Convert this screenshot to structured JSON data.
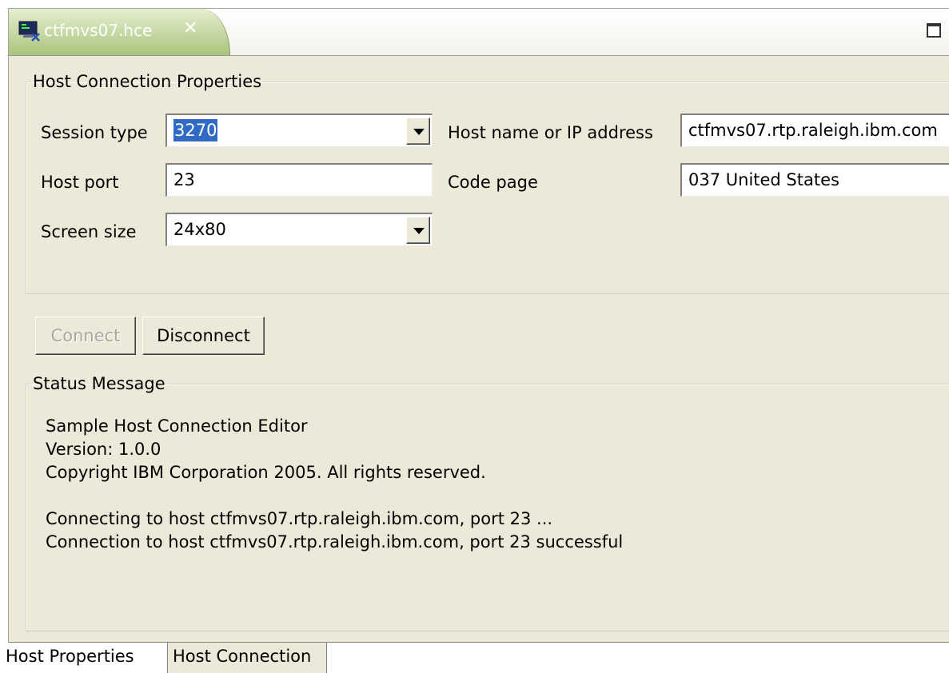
{
  "editor_tab": {
    "title": "ctfmvs07.hce",
    "icon": "terminal-icon",
    "close_icon": "close-icon"
  },
  "maximize_icon": "maximize-icon",
  "host_connection": {
    "legend": "Host Connection Properties",
    "session_type_label": "Session type",
    "session_type_value": "3270",
    "host_name_label": "Host name or IP address",
    "host_name_value": "ctfmvs07.rtp.raleigh.ibm.com",
    "host_port_label": "Host port",
    "host_port_value": "23",
    "code_page_label": "Code page",
    "code_page_value": "037 United States",
    "screen_size_label": "Screen size",
    "screen_size_value": "24x80"
  },
  "buttons": {
    "connect": "Connect",
    "disconnect": "Disconnect"
  },
  "status": {
    "legend": "Status Message",
    "lines": [
      "Sample Host Connection Editor",
      "Version:  1.0.0",
      "Copyright IBM Corporation 2005. All rights reserved.",
      "",
      "Connecting to host ctfmvs07.rtp.raleigh.ibm.com, port 23 ...",
      "Connection to host ctfmvs07.rtp.raleigh.ibm.com, port 23 successful"
    ]
  },
  "bottom_tabs": [
    {
      "label": "Host Properties",
      "active": true
    },
    {
      "label": "Host Connection",
      "active": false
    }
  ],
  "colors": {
    "tab_active": "#a9c47c",
    "selection": "#316ac5",
    "panel_bg": "#ece9d8"
  }
}
